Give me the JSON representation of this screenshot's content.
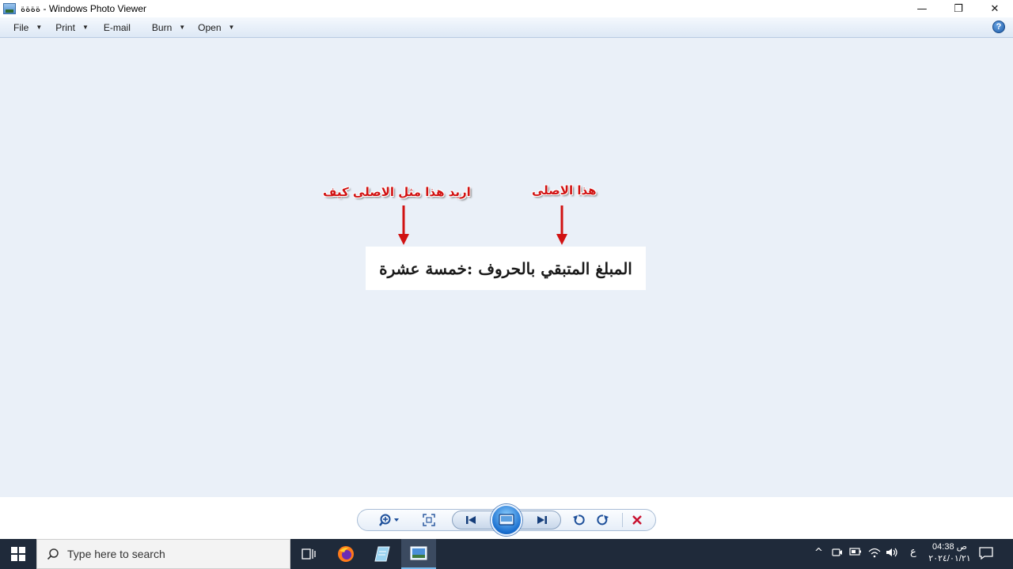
{
  "window": {
    "title": "ةةةة - Windows Photo Viewer",
    "controls": {
      "minimize": "—",
      "restore": "❐",
      "close": "✕"
    }
  },
  "menu": {
    "items": [
      {
        "label": "File",
        "dropdown": true
      },
      {
        "label": "Print",
        "dropdown": true
      },
      {
        "label": "E-mail",
        "dropdown": false
      },
      {
        "label": "Burn",
        "dropdown": true
      },
      {
        "label": "Open",
        "dropdown": true
      }
    ],
    "help_label": "?"
  },
  "photo": {
    "text": "المبلغ المتبقي بالحروف :خمسة عشرة",
    "annotation_left": "اريد هذا مثل الاصلى كيف",
    "annotation_right": "هذا الاصلى",
    "annotation_color": "#d11212"
  },
  "controls": {
    "icons": [
      "zoom-icon",
      "actual-size-icon",
      "previous-icon",
      "slideshow-icon",
      "next-icon",
      "rotate-counterclockwise-icon",
      "rotate-clockwise-icon",
      "delete-icon"
    ]
  },
  "taskbar": {
    "search_placeholder": "Type here to search",
    "tray": {
      "language": "ع",
      "time": "04:38 ص",
      "date": "٢٠٢٤/٠١/٢١"
    }
  },
  "colors": {
    "viewer_bg": "#eaf0f8",
    "taskbar_bg": "#1f2a3a",
    "accent": "#1a6fcf"
  }
}
